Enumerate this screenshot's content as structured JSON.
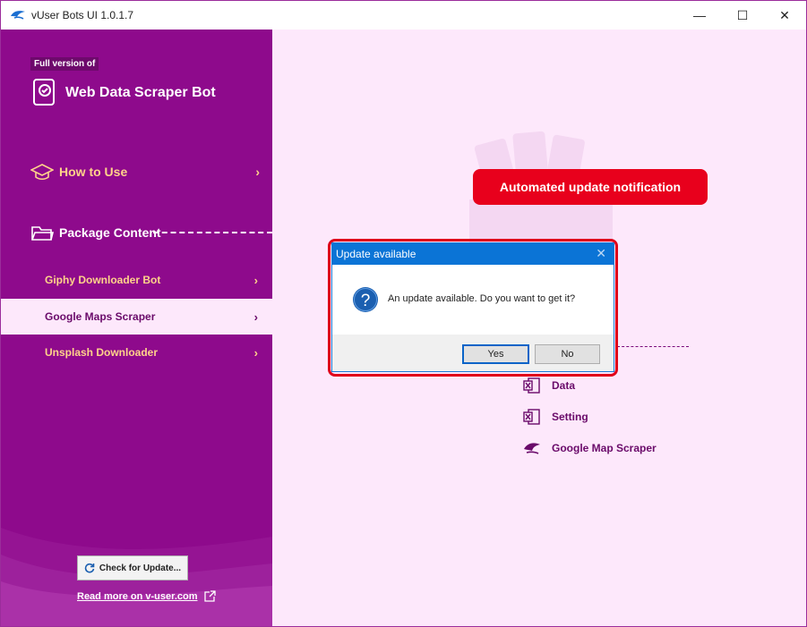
{
  "window": {
    "title": "vUser Bots UI 1.0.1.7",
    "controls": {
      "minimize": "—",
      "maximize": "☐",
      "close": "✕"
    }
  },
  "sidebar": {
    "badge": "Full version of",
    "app_title": "Web Data Scraper Bot",
    "how_to_use": "How to Use",
    "package_content": "Package Content",
    "chevron": "›",
    "items": [
      {
        "label": "Giphy Downloader Bot",
        "active": false
      },
      {
        "label": "Google Maps Scraper",
        "active": true
      },
      {
        "label": "Unsplash Downloader",
        "active": false
      }
    ],
    "check_update": "Check for Update...",
    "read_more": "Read more on v-user.com"
  },
  "content": {
    "callout": "Automated update notification",
    "files": [
      {
        "label": "Data",
        "icon": "excel-icon"
      },
      {
        "label": "Setting",
        "icon": "excel-icon"
      },
      {
        "label": "Google Map Scraper",
        "icon": "bot-icon"
      }
    ]
  },
  "dialog": {
    "title": "Update available",
    "message": "An update available. Do you want to get it?",
    "yes": "Yes",
    "no": "No",
    "close": "✕"
  },
  "colors": {
    "sidebar": "#8e0a8c",
    "accent": "#ffd38a",
    "content_bg": "#fde8fb",
    "callout": "#e8001c",
    "dialog_title": "#0b74d6"
  }
}
